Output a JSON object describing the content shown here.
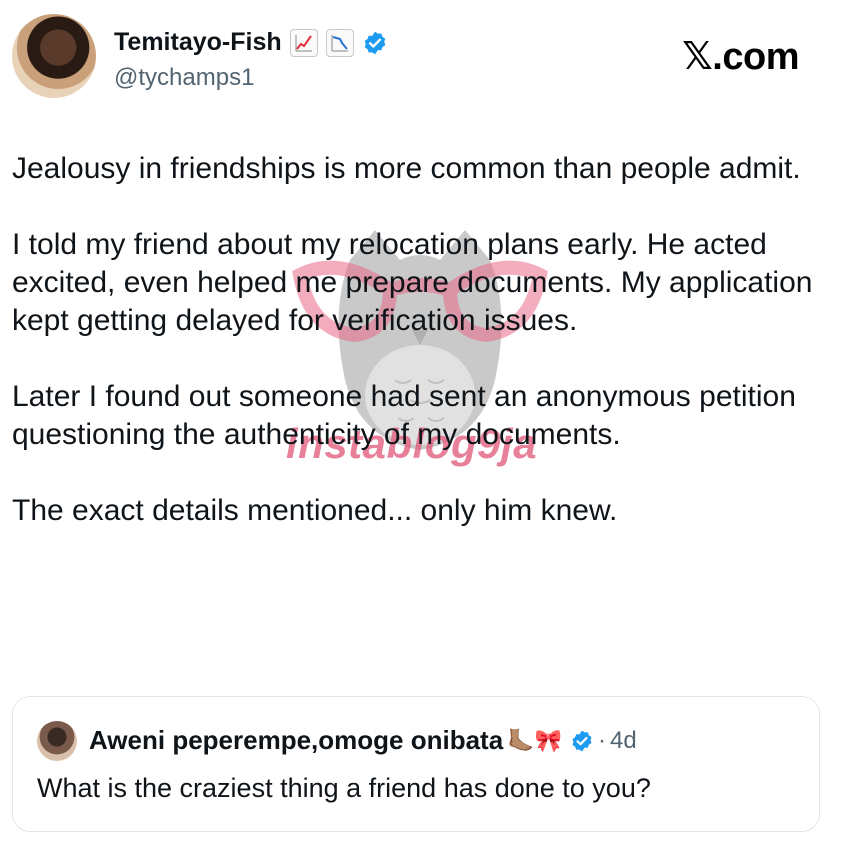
{
  "author": {
    "display_name": "Temitayo-Fish",
    "handle": "@tychamps1",
    "name_icons": [
      "chart-increasing-icon",
      "chart-decreasing-icon",
      "verified-badge-icon"
    ]
  },
  "brand": {
    "label": ".com"
  },
  "post": {
    "paragraphs": [
      "Jealousy in friendships is more common than people admit.",
      "I told my friend about my relocation plans early. He acted excited, even helped me prepare documents. My application kept getting delayed for verification issues.",
      "Later I found out someone had sent an anonymous petition questioning the authenticity of my documents.",
      "The exact details mentioned... only him knew."
    ]
  },
  "watermark": {
    "text": "instablog9ja"
  },
  "quoted_post": {
    "display_name": "Aweni peperempe,omoge onibata",
    "emojis": "🦶🏽🎀",
    "separator": "·",
    "time": "4d",
    "text": "What is the craziest thing a friend has done to you?"
  },
  "colors": {
    "verified": "#1d9bf0",
    "secondary_text": "#536471",
    "watermark_pink": "#e25678"
  }
}
